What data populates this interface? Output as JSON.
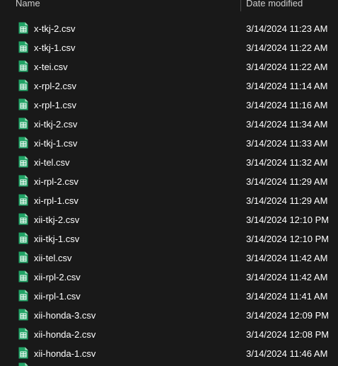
{
  "columns": {
    "name": "Name",
    "date_modified": "Date modified"
  },
  "icon": {
    "name": "csv-spreadsheet-icon",
    "color": "#21A366",
    "fold_color": "#A8E6C4"
  },
  "files": [
    {
      "name": "x-tkj-2.csv",
      "date": "3/14/2024 11:23 AM"
    },
    {
      "name": "x-tkj-1.csv",
      "date": "3/14/2024 11:22 AM"
    },
    {
      "name": "x-tei.csv",
      "date": "3/14/2024 11:22 AM"
    },
    {
      "name": "x-rpl-2.csv",
      "date": "3/14/2024 11:14 AM"
    },
    {
      "name": "x-rpl-1.csv",
      "date": "3/14/2024 11:16 AM"
    },
    {
      "name": "xi-tkj-2.csv",
      "date": "3/14/2024 11:34 AM"
    },
    {
      "name": "xi-tkj-1.csv",
      "date": "3/14/2024 11:33 AM"
    },
    {
      "name": "xi-tel.csv",
      "date": "3/14/2024 11:32 AM"
    },
    {
      "name": "xi-rpl-2.csv",
      "date": "3/14/2024 11:29 AM"
    },
    {
      "name": "xi-rpl-1.csv",
      "date": "3/14/2024 11:29 AM"
    },
    {
      "name": "xii-tkj-2.csv",
      "date": "3/14/2024 12:10 PM"
    },
    {
      "name": "xii-tkj-1.csv",
      "date": "3/14/2024 12:10 PM"
    },
    {
      "name": "xii-tel.csv",
      "date": "3/14/2024 11:42 AM"
    },
    {
      "name": "xii-rpl-2.csv",
      "date": "3/14/2024 11:42 AM"
    },
    {
      "name": "xii-rpl-1.csv",
      "date": "3/14/2024 11:41 AM"
    },
    {
      "name": "xii-honda-3.csv",
      "date": "3/14/2024 12:09 PM"
    },
    {
      "name": "xii-honda-2.csv",
      "date": "3/14/2024 12:08 PM"
    },
    {
      "name": "xii-honda-1.csv",
      "date": "3/14/2024 11:46 AM"
    }
  ]
}
